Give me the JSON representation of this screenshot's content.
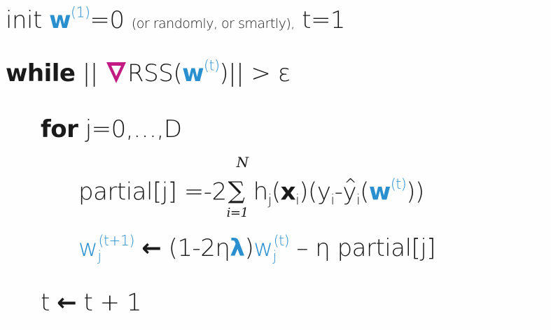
{
  "line1": {
    "init": "init",
    "w": "w",
    "w_sup": "(1)",
    "eq0": "=0",
    "note": "(or randomly, or smartly),",
    "t1": "t=1"
  },
  "line2": {
    "while": "while",
    "open": "||",
    "rss": "RSS(",
    "w": "w",
    "w_sup": "(t)",
    "close": ")|| > ε"
  },
  "line3": {
    "for": "for",
    "range": "j=0,…,D"
  },
  "line4": {
    "lhs": "partial[j] =-2",
    "sum_top": "N",
    "sum_bot": "i=1",
    "sum_sym": "∑",
    "h": "h",
    "h_sub": "j",
    "x_open": "(",
    "x": "x",
    "x_sub": "i",
    "x_close": ")(y",
    "y_sub": "i",
    "minus": "-",
    "yhat": "y",
    "yhat_sub": "i",
    "w_open": "(",
    "w": "w",
    "w_sup": "(t)",
    "close": "))"
  },
  "line5": {
    "w": "w",
    "w_sub": "j",
    "w_sup": "(t+1)",
    "arrow": "🡐",
    "mid1": " (1-2η",
    "lambda": "λ",
    "mid2": ")",
    "w2": "w",
    "w2_sub": "j",
    "w2_sup": "(t)",
    "tail": " – η partial[j]"
  },
  "line6": {
    "t": "t",
    "arrow": "🡐",
    "rhs": "t + 1"
  },
  "colors": {
    "blue": "#2a8fcf",
    "magenta": "#c21b83"
  }
}
